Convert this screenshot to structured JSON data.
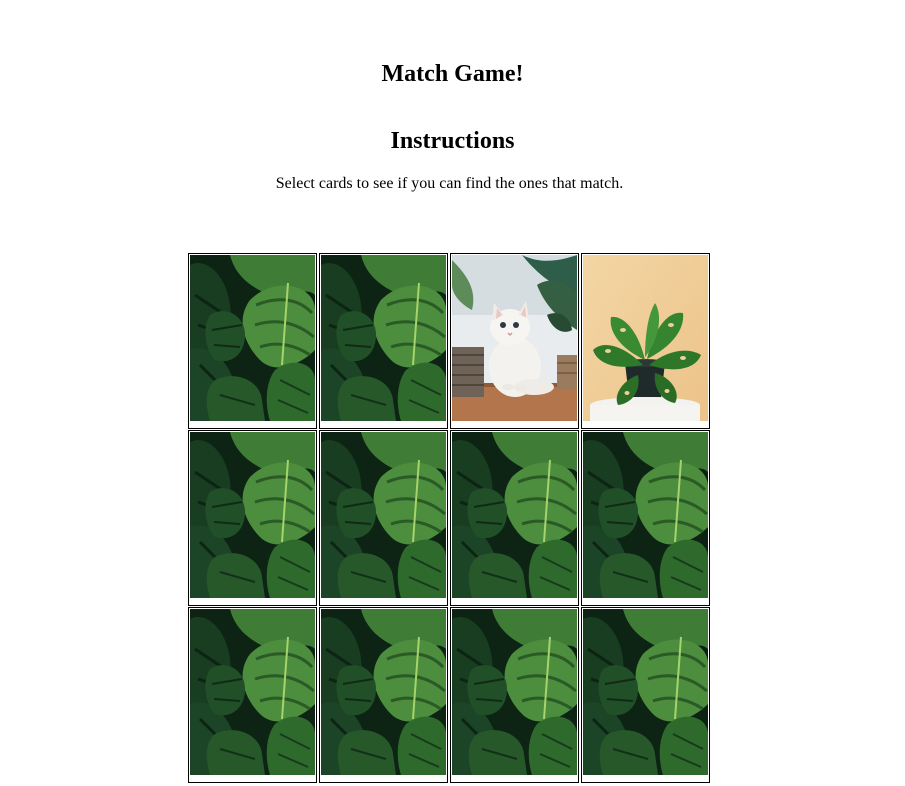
{
  "page": {
    "title": "Match Game!",
    "instructions_heading": "Instructions",
    "instructions_text": "Select cards to see if you can find the ones that match."
  },
  "board": {
    "rows": 3,
    "columns": 4,
    "cards": [
      {
        "state": "face-down",
        "image": "monstera-leaves-card-back"
      },
      {
        "state": "face-down",
        "image": "monstera-leaves-card-back"
      },
      {
        "state": "face-up",
        "image": "white-kitten-with-plants"
      },
      {
        "state": "face-up",
        "image": "potted-monstera-plant"
      },
      {
        "state": "face-down",
        "image": "monstera-leaves-card-back"
      },
      {
        "state": "face-down",
        "image": "monstera-leaves-card-back"
      },
      {
        "state": "face-down",
        "image": "monstera-leaves-card-back"
      },
      {
        "state": "face-down",
        "image": "monstera-leaves-card-back"
      },
      {
        "state": "face-down",
        "image": "monstera-leaves-card-back"
      },
      {
        "state": "face-down",
        "image": "monstera-leaves-card-back"
      },
      {
        "state": "face-down",
        "image": "monstera-leaves-card-back"
      },
      {
        "state": "face-down",
        "image": "monstera-leaves-card-back"
      }
    ]
  },
  "colors": {
    "leaf_dark": "#0f2a16",
    "leaf_mid": "#2f6b2e",
    "leaf_light": "#5ea04a",
    "peach_background": "#f0cf97",
    "wood_floor": "#b77a4f"
  }
}
